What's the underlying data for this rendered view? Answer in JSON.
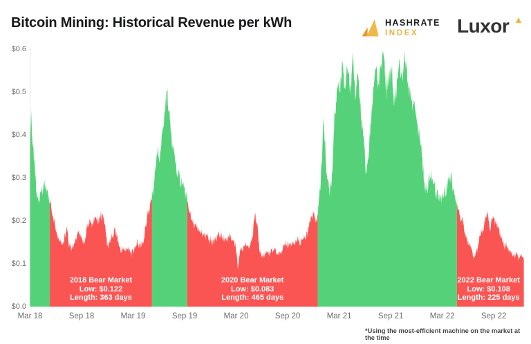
{
  "header": {
    "title": "Bitcoin Mining: Historical Revenue per kWh",
    "hashrate_index": {
      "line1": "HASHRATE",
      "line2": "INDEX"
    },
    "luxor": {
      "text": "Luxor"
    }
  },
  "footnote": "*Using the most-efficient machine on the market at the time",
  "colors": {
    "bull_green": "#55d279",
    "bear_red": "#fa5453",
    "gold_dark": "#e49b2f",
    "gold_light": "#f0b845",
    "axis_text": "#6d6d6d"
  },
  "chart_data": {
    "type": "area",
    "title": "Bitcoin Mining: Historical Revenue per kWh",
    "unit": "USD revenue per kWh (most-efficient machine)",
    "grid": false,
    "legend_position": "none",
    "x_axis": {
      "start": "Mar 2018",
      "end": "Dec 2022",
      "months_between_ticks": 6,
      "ticks": [
        "Mar 18",
        "Sep 18",
        "Mar 19",
        "Sep 19",
        "Mar 20",
        "Sep 20",
        "Mar 21",
        "Sep 21",
        "Mar 22",
        "Sep 22"
      ]
    },
    "y_axis": {
      "lim": [
        0,
        0.6
      ],
      "ticks": [
        "$0.0",
        "$0.1",
        "$0.2",
        "$0.3",
        "$0.4",
        "$0.5",
        "$0.6"
      ]
    },
    "segments": [
      {
        "market": "bull",
        "from_month": 0,
        "to_month": 2.3
      },
      {
        "market": "bear",
        "from_month": 2.3,
        "to_month": 14.2,
        "name": "2018 Bear Market",
        "low_usd": 0.122,
        "length_days": 363
      },
      {
        "market": "bull",
        "from_month": 14.2,
        "to_month": 18.3
      },
      {
        "market": "bear",
        "from_month": 18.3,
        "to_month": 33.5,
        "name": "2020 Bear Market",
        "low_usd": 0.083,
        "length_days": 465
      },
      {
        "market": "bull",
        "from_month": 33.5,
        "to_month": 49.7
      },
      {
        "market": "bear",
        "from_month": 49.7,
        "to_month": 57.5,
        "name": "2022 Bear Market",
        "low_usd": 0.108,
        "length_days": 225
      }
    ],
    "annotations": [
      {
        "title": "2018 Bear Market",
        "low": "Low: $0.122",
        "length": "Length: 363 days",
        "center_month": 8.25
      },
      {
        "title": "2020 Bear Market",
        "low": "Low: $0.083",
        "length": "Length: 465 days",
        "center_month": 25.9
      },
      {
        "title": "2022 Bear Market",
        "low": "Low: $0.108",
        "length": "Length: 225 days",
        "center_month": 53.4
      }
    ],
    "anchor_points_month_usd": [
      [
        0,
        0.37
      ],
      [
        0.12,
        0.45
      ],
      [
        0.3,
        0.39
      ],
      [
        0.5,
        0.345
      ],
      [
        0.8,
        0.27
      ],
      [
        1.05,
        0.235
      ],
      [
        1.3,
        0.26
      ],
      [
        1.6,
        0.28
      ],
      [
        1.85,
        0.275
      ],
      [
        2.1,
        0.262
      ],
      [
        2.3,
        0.247
      ],
      [
        2.6,
        0.21
      ],
      [
        2.9,
        0.185
      ],
      [
        3.2,
        0.165
      ],
      [
        3.5,
        0.152
      ],
      [
        3.8,
        0.148
      ],
      [
        4.1,
        0.158
      ],
      [
        4.3,
        0.188
      ],
      [
        4.5,
        0.15
      ],
      [
        4.8,
        0.138
      ],
      [
        5.1,
        0.142
      ],
      [
        5.4,
        0.155
      ],
      [
        5.7,
        0.168
      ],
      [
        6.0,
        0.155
      ],
      [
        6.3,
        0.15
      ],
      [
        6.7,
        0.185
      ],
      [
        7.0,
        0.2
      ],
      [
        7.3,
        0.19
      ],
      [
        7.6,
        0.21
      ],
      [
        8.0,
        0.205
      ],
      [
        8.3,
        0.212
      ],
      [
        8.6,
        0.196
      ],
      [
        9.0,
        0.142
      ],
      [
        9.4,
        0.152
      ],
      [
        9.9,
        0.18
      ],
      [
        10.2,
        0.16
      ],
      [
        10.5,
        0.135
      ],
      [
        11.0,
        0.133
      ],
      [
        11.5,
        0.138
      ],
      [
        12.0,
        0.132
      ],
      [
        12.4,
        0.145
      ],
      [
        12.8,
        0.148
      ],
      [
        13.2,
        0.152
      ],
      [
        13.6,
        0.21
      ],
      [
        13.9,
        0.225
      ],
      [
        14.2,
        0.25
      ],
      [
        14.5,
        0.3
      ],
      [
        14.8,
        0.355
      ],
      [
        15.1,
        0.34
      ],
      [
        15.4,
        0.4
      ],
      [
        15.9,
        0.485
      ],
      [
        16.3,
        0.44
      ],
      [
        16.5,
        0.39
      ],
      [
        16.9,
        0.34
      ],
      [
        17.1,
        0.31
      ],
      [
        17.35,
        0.325
      ],
      [
        17.7,
        0.295
      ],
      [
        18.0,
        0.275
      ],
      [
        18.3,
        0.245
      ],
      [
        18.5,
        0.222
      ],
      [
        18.8,
        0.196
      ],
      [
        19.2,
        0.19
      ],
      [
        19.6,
        0.18
      ],
      [
        20.0,
        0.17
      ],
      [
        20.5,
        0.16
      ],
      [
        21.0,
        0.155
      ],
      [
        21.5,
        0.162
      ],
      [
        22.0,
        0.17
      ],
      [
        22.5,
        0.16
      ],
      [
        23.0,
        0.155
      ],
      [
        23.4,
        0.16
      ],
      [
        23.8,
        0.145
      ],
      [
        24.0,
        0.13
      ],
      [
        24.2,
        0.085
      ],
      [
        24.45,
        0.125
      ],
      [
        24.8,
        0.135
      ],
      [
        25.2,
        0.14
      ],
      [
        25.6,
        0.15
      ],
      [
        25.9,
        0.16
      ],
      [
        26.2,
        0.225
      ],
      [
        26.45,
        0.19
      ],
      [
        26.7,
        0.135
      ],
      [
        27.0,
        0.125
      ],
      [
        27.4,
        0.12
      ],
      [
        27.8,
        0.125
      ],
      [
        28.2,
        0.13
      ],
      [
        28.6,
        0.125
      ],
      [
        29.0,
        0.122
      ],
      [
        29.4,
        0.13
      ],
      [
        29.8,
        0.138
      ],
      [
        30.2,
        0.14
      ],
      [
        30.6,
        0.147
      ],
      [
        31.0,
        0.155
      ],
      [
        31.5,
        0.15
      ],
      [
        32.0,
        0.16
      ],
      [
        32.5,
        0.185
      ],
      [
        33.0,
        0.209
      ],
      [
        33.3,
        0.196
      ],
      [
        33.5,
        0.21
      ],
      [
        33.8,
        0.27
      ],
      [
        34.2,
        0.43
      ],
      [
        34.5,
        0.33
      ],
      [
        34.9,
        0.27
      ],
      [
        35.2,
        0.32
      ],
      [
        35.5,
        0.46
      ],
      [
        35.8,
        0.52
      ],
      [
        36.1,
        0.49
      ],
      [
        36.4,
        0.555
      ],
      [
        36.7,
        0.5
      ],
      [
        37.0,
        0.565
      ],
      [
        37.3,
        0.51
      ],
      [
        37.6,
        0.577
      ],
      [
        37.9,
        0.5
      ],
      [
        38.2,
        0.535
      ],
      [
        38.5,
        0.46
      ],
      [
        38.8,
        0.4
      ],
      [
        39.1,
        0.3
      ],
      [
        39.4,
        0.33
      ],
      [
        39.7,
        0.42
      ],
      [
        40.0,
        0.5
      ],
      [
        40.3,
        0.55
      ],
      [
        40.6,
        0.5
      ],
      [
        40.9,
        0.545
      ],
      [
        41.2,
        0.57
      ],
      [
        41.5,
        0.49
      ],
      [
        41.8,
        0.53
      ],
      [
        42.1,
        0.555
      ],
      [
        42.4,
        0.48
      ],
      [
        42.7,
        0.52
      ],
      [
        43.0,
        0.55
      ],
      [
        43.3,
        0.52
      ],
      [
        43.6,
        0.582
      ],
      [
        43.9,
        0.55
      ],
      [
        44.2,
        0.5
      ],
      [
        44.5,
        0.46
      ],
      [
        44.9,
        0.47
      ],
      [
        45.2,
        0.42
      ],
      [
        45.5,
        0.38
      ],
      [
        45.8,
        0.32
      ],
      [
        46.1,
        0.28
      ],
      [
        46.4,
        0.3
      ],
      [
        46.7,
        0.31
      ],
      [
        47.0,
        0.28
      ],
      [
        47.3,
        0.26
      ],
      [
        47.6,
        0.255
      ],
      [
        47.9,
        0.252
      ],
      [
        48.2,
        0.265
      ],
      [
        48.5,
        0.28
      ],
      [
        48.8,
        0.3
      ],
      [
        49.0,
        0.305
      ],
      [
        49.3,
        0.27
      ],
      [
        49.5,
        0.25
      ],
      [
        49.7,
        0.238
      ],
      [
        49.9,
        0.225
      ],
      [
        50.2,
        0.2
      ],
      [
        50.5,
        0.185
      ],
      [
        50.8,
        0.165
      ],
      [
        51.1,
        0.15
      ],
      [
        51.4,
        0.135
      ],
      [
        51.8,
        0.115
      ],
      [
        52.1,
        0.14
      ],
      [
        52.4,
        0.165
      ],
      [
        52.7,
        0.185
      ],
      [
        53.0,
        0.2
      ],
      [
        53.3,
        0.211
      ],
      [
        53.6,
        0.19
      ],
      [
        53.9,
        0.2
      ],
      [
        54.2,
        0.193
      ],
      [
        54.5,
        0.175
      ],
      [
        54.8,
        0.16
      ],
      [
        55.1,
        0.15
      ],
      [
        55.4,
        0.143
      ],
      [
        55.7,
        0.135
      ],
      [
        56.0,
        0.128
      ],
      [
        56.3,
        0.122
      ],
      [
        56.6,
        0.118
      ],
      [
        56.9,
        0.112
      ],
      [
        57.2,
        0.118
      ],
      [
        57.5,
        0.124
      ]
    ]
  }
}
